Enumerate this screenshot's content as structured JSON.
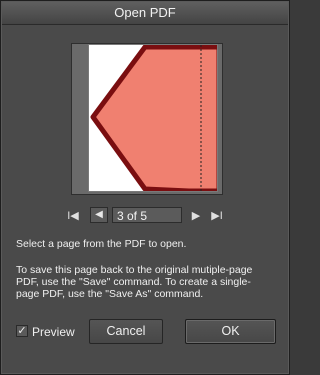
{
  "dialog": {
    "title": "Open PDF"
  },
  "navigation": {
    "first_icon": "first-page-icon",
    "prev_icon": "prev-page-icon",
    "next_icon": "next-page-icon",
    "last_icon": "last-page-icon",
    "page_value": "3 of 5"
  },
  "text": {
    "select_prompt": "Select a page from the PDF to open.",
    "save_line1": "To save this page back to the original mutiple-page",
    "save_line2": "PDF, use the \"Save\" command. To create a single-",
    "save_line3": "page PDF, use the \"Save As\" command."
  },
  "footer": {
    "preview_label": "Preview",
    "preview_checked": true,
    "cancel_label": "Cancel",
    "ok_label": "OK"
  },
  "colors": {
    "shape_fill": "#f07a6a",
    "shape_stroke": "#7a0e10"
  }
}
